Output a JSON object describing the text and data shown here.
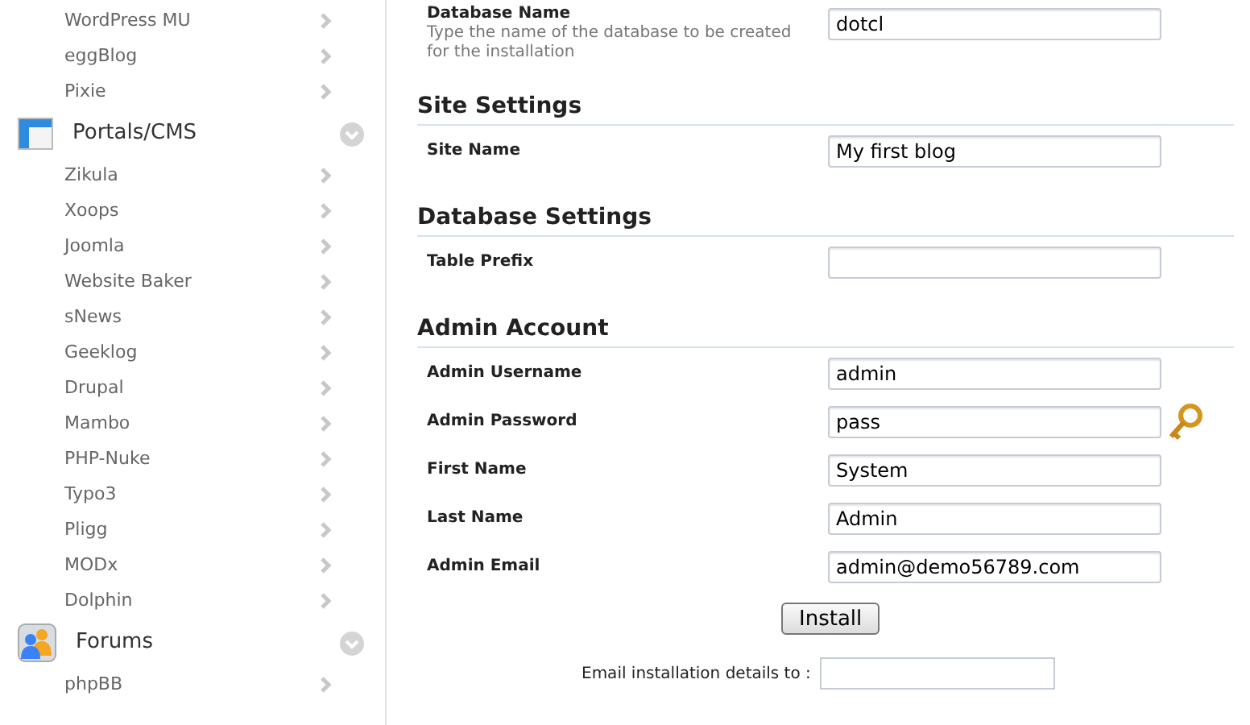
{
  "sidebar": {
    "sections": [
      {
        "items": [
          "WordPress MU",
          "eggBlog",
          "Pixie"
        ]
      },
      {
        "title": "Portals/CMS",
        "items": [
          "Zikula",
          "Xoops",
          "Joomla",
          "Website Baker",
          "sNews",
          "Geeklog",
          "Drupal",
          "Mambo",
          "PHP-Nuke",
          "Typo3",
          "Pligg",
          "MODx",
          "Dolphin"
        ]
      },
      {
        "title": "Forums",
        "items": [
          "phpBB"
        ]
      }
    ]
  },
  "form": {
    "top_field": {
      "label": "Database Name",
      "hint": "Type the name of the database to be created for the installation",
      "value": "dotcl"
    },
    "sections": [
      {
        "title": "Site Settings",
        "fields": [
          {
            "label": "Site Name",
            "value": "My first blog"
          }
        ]
      },
      {
        "title": "Database Settings",
        "fields": [
          {
            "label": "Table Prefix"
          }
        ]
      },
      {
        "title": "Admin Account",
        "fields": [
          {
            "label": "Admin Username",
            "value": "admin"
          },
          {
            "label": "Admin Password",
            "value": "pass",
            "kind": "password"
          },
          {
            "label": "First Name",
            "value": "System"
          },
          {
            "label": "Last Name",
            "value": "Admin"
          },
          {
            "label": "Admin Email",
            "value": "admin@demo56789.com"
          }
        ]
      }
    ],
    "install_button": "Install",
    "email_label": "Email installation details to :"
  }
}
